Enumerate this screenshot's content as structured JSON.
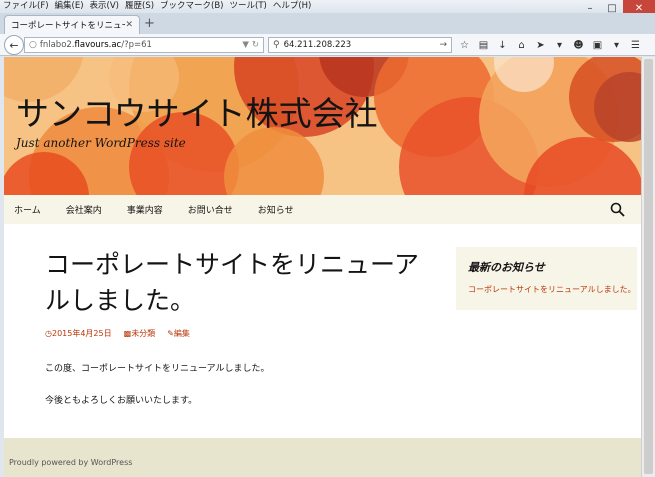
{
  "browser": {
    "menu": [
      "ファイル(F)",
      "編集(E)",
      "表示(V)",
      "履歴(S)",
      "ブックマーク(B)",
      "ツール(T)",
      "ヘルプ(H)"
    ],
    "tab_title": "コーポレートサイトをリニューアルし...",
    "new_tab": "+",
    "url_path_prefix": "fnlabo2.",
    "url_domain": "flavours.ac",
    "url_suffix": "/?p=61",
    "search_value": "64.211.208.223",
    "icons": [
      "star-icon",
      "reader-icon",
      "download-icon",
      "home-icon",
      "extension-icon",
      "menu-dropdown-icon",
      "chat-icon",
      "screenshot-icon",
      "menu-dropdown-icon",
      "hamburger-icon"
    ]
  },
  "site": {
    "title": "サンコウサイト株式会社",
    "description": "Just another WordPress site",
    "nav": [
      "ホーム",
      "会社案内",
      "事業内容",
      "お問い合せ",
      "お知らせ"
    ]
  },
  "post": {
    "title": "コーポレートサイトをリニューアルしました。",
    "date": "2015年4月25日",
    "category": "未分類",
    "edit": "編集",
    "paragraphs": [
      "この度、コーポレートサイトをリニューアルしました。",
      "今後ともよろしくお願いいたします。"
    ]
  },
  "sidebar": {
    "widget_title": "最新のお知らせ",
    "link": "コーポレートサイトをリニューアルしました。"
  },
  "footer": {
    "credit": "Proudly powered by WordPress"
  },
  "colors": {
    "accent": "#bc360a",
    "nav_bg": "#f7f5e7",
    "footer_bg": "#e8e5ce"
  }
}
